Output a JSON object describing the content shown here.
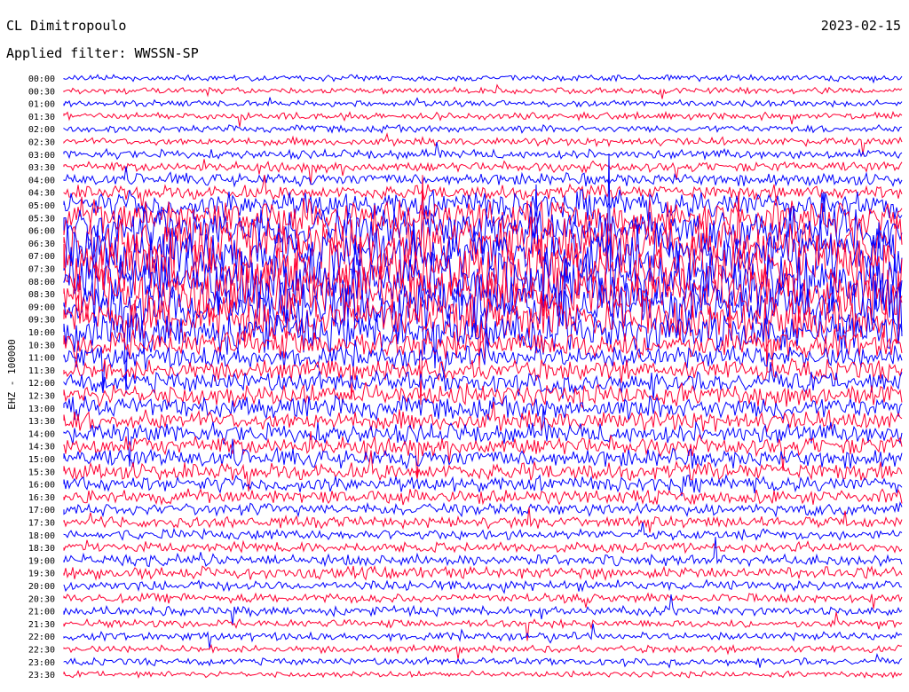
{
  "header": {
    "station": "CL Dimitropoulo",
    "date": "2023-02-15",
    "filter_text": "Applied filter: WWSSN-SP"
  },
  "chart_data": {
    "type": "line",
    "title": "CL Dimitropoulo",
    "ylabel": "EHZ - 100000",
    "colors": [
      "#0000ff",
      "#ff0033"
    ],
    "tick_labels": [
      "00:00",
      "00:30",
      "01:00",
      "01:30",
      "02:00",
      "02:30",
      "03:00",
      "03:30",
      "04:00",
      "04:30",
      "05:00",
      "05:30",
      "06:00",
      "06:30",
      "07:00",
      "07:30",
      "08:00",
      "08:30",
      "09:00",
      "09:30",
      "10:00",
      "10:30",
      "11:00",
      "11:30",
      "12:00",
      "12:30",
      "13:00",
      "13:30",
      "14:00",
      "14:30",
      "15:00",
      "15:30",
      "16:00",
      "16:30",
      "17:00",
      "17:30",
      "18:00",
      "18:30",
      "19:00",
      "19:30",
      "20:00",
      "20:30",
      "21:00",
      "21:30",
      "22:00",
      "22:30",
      "23:00",
      "23:30"
    ],
    "amplitude": [
      0.3,
      0.3,
      0.3,
      0.35,
      0.35,
      0.4,
      0.45,
      0.5,
      0.6,
      0.7,
      1.4,
      1.8,
      2.2,
      2.5,
      2.8,
      3.0,
      3.0,
      2.8,
      2.6,
      2.3,
      2.0,
      1.4,
      1.1,
      1.0,
      1.0,
      1.1,
      1.1,
      1.0,
      1.0,
      0.95,
      0.9,
      0.85,
      0.8,
      0.7,
      0.6,
      0.55,
      0.5,
      0.5,
      0.55,
      0.6,
      0.5,
      0.45,
      0.45,
      0.4,
      0.4,
      0.35,
      0.35,
      0.3
    ],
    "grid": false
  }
}
